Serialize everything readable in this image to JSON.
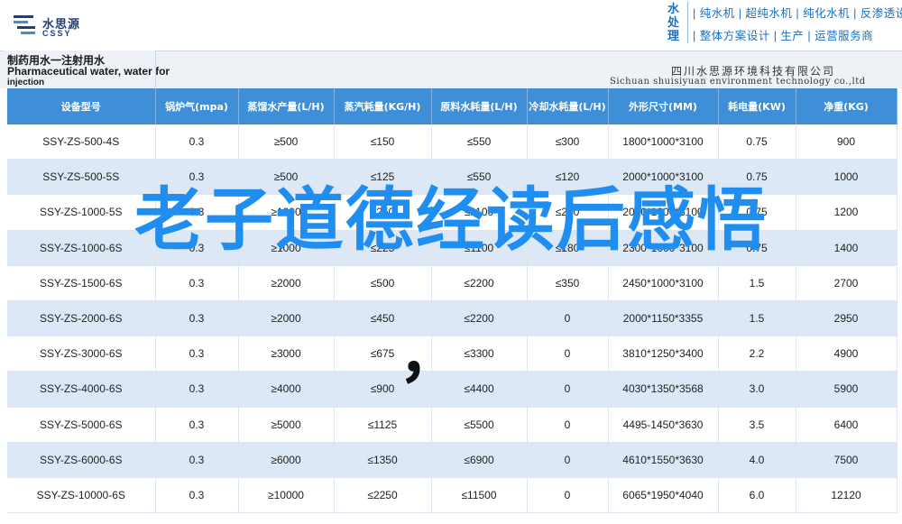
{
  "header": {
    "logo_cn": "水思源",
    "logo_en": "CSSY",
    "slogan_tag": "水处理",
    "slogan_line1": "| 纯水机 | 超纯水机 | 纯化水机 | 反渗透设备",
    "slogan_line2": "| 整体方案设计 | 生产 | 运营服务商"
  },
  "band": {
    "title_line1": "制药用水一注射用水",
    "title_line2": "Pharmaceutical water, water for",
    "title_line3": "injection",
    "company_cn": "四川水思源环境科技有限公司",
    "company_en": "Sichuan shuisiyuan environment technology co.,ltd"
  },
  "overlay": {
    "title": "老子道德经读后感悟",
    "comma": "，"
  },
  "table": {
    "headers": [
      "设备型号",
      "锅炉气(mpa)",
      "蒸馏水产量(L/H)",
      "蒸汽耗量(KG/H)",
      "原料水耗量(L/H)",
      "冷却水耗量(L/H)",
      "外形尺寸(MM)",
      "耗电量(KW)",
      "净重(KG)"
    ],
    "rows": [
      [
        "SSY-ZS-500-4S",
        "0.3",
        "≥500",
        "≤150",
        "≤550",
        "≤300",
        "1800*1000*3100",
        "0.75",
        "900"
      ],
      [
        "SSY-ZS-500-5S",
        "0.3",
        "≥500",
        "≤125",
        "≤550",
        "≤120",
        "2000*1000*3100",
        "0.75",
        "1000"
      ],
      [
        "SSY-ZS-1000-5S",
        "0.3",
        "≥1000",
        "≤250",
        "≤1100",
        "≤240",
        "2000*1000*3100",
        "0.75",
        "1200"
      ],
      [
        "SSY-ZS-1000-6S",
        "0.3",
        "≥1000",
        "≤225",
        "≤1100",
        "≤180",
        "2300*1000*3100",
        "0.75",
        "1400"
      ],
      [
        "SSY-ZS-1500-6S",
        "0.3",
        "≥2000",
        "≤500",
        "≤2200",
        "≤350",
        "2450*1000*3100",
        "1.5",
        "2700"
      ],
      [
        "SSY-ZS-2000-6S",
        "0.3",
        "≥2000",
        "≤450",
        "≤2200",
        "0",
        "2000*1150*3355",
        "1.5",
        "2950"
      ],
      [
        "SSY-ZS-3000-6S",
        "0.3",
        "≥3000",
        "≤675",
        "≤3300",
        "0",
        "3810*1250*3400",
        "2.2",
        "4900"
      ],
      [
        "SSY-ZS-4000-6S",
        "0.3",
        "≥4000",
        "≤900",
        "≤4400",
        "0",
        "4030*1350*3568",
        "3.0",
        "5900"
      ],
      [
        "SSY-ZS-5000-6S",
        "0.3",
        "≥5000",
        "≤1125",
        "≤5500",
        "0",
        "4495-1450*3630",
        "3.5",
        "6400"
      ],
      [
        "SSY-ZS-6000-6S",
        "0.3",
        "≥6000",
        "≤1350",
        "≤6900",
        "0",
        "4610*1550*3630",
        "4.0",
        "7500"
      ],
      [
        "SSY-ZS-10000-6S",
        "0.3",
        "≥10000",
        "≤2250",
        "≤11500",
        "0",
        "6065*1950*4040",
        "6.0",
        "12120"
      ]
    ]
  }
}
